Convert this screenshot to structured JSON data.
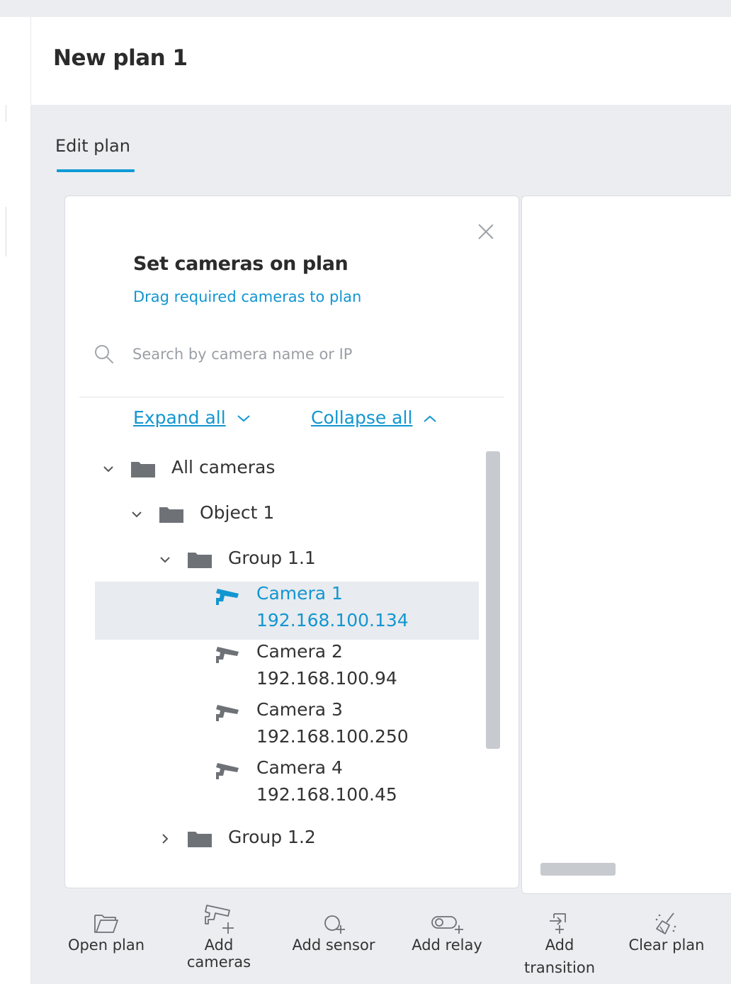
{
  "page": {
    "title": "New plan 1"
  },
  "tabs": [
    {
      "label": "Edit plan",
      "active": true
    }
  ],
  "panel": {
    "title": "Set cameras on plan",
    "subtitle": "Drag required cameras to plan",
    "search": {
      "placeholder": "Search by camera name or IP",
      "value": ""
    },
    "expand_all": "Expand all",
    "collapse_all": "Collapse all"
  },
  "tree": {
    "root": {
      "label": "All cameras",
      "expanded": true
    },
    "object": {
      "label": "Object 1",
      "expanded": true
    },
    "group1": {
      "label": "Group 1.1",
      "expanded": true
    },
    "cameras": [
      {
        "name": "Camera 1",
        "ip": "192.168.100.134",
        "selected": true
      },
      {
        "name": "Camera 2",
        "ip": "192.168.100.94",
        "selected": false
      },
      {
        "name": "Camera 3",
        "ip": "192.168.100.250",
        "selected": false
      },
      {
        "name": "Camera 4",
        "ip": "192.168.100.45",
        "selected": false
      }
    ],
    "group2": {
      "label": "Group 1.2",
      "expanded": false
    }
  },
  "toolbar": {
    "open_plan": "Open plan",
    "add_cameras_1": "Add",
    "add_cameras_2": "cameras",
    "add_sensor": "Add sensor",
    "add_relay": "Add relay",
    "add_transition_1": "Add",
    "add_transition_2": "transition",
    "clear_plan": "Clear plan"
  },
  "colors": {
    "accent": "#1296d1",
    "background": "#ebedf0",
    "selected_row": "#e8ebef",
    "icon_gray": "#6e7277"
  }
}
